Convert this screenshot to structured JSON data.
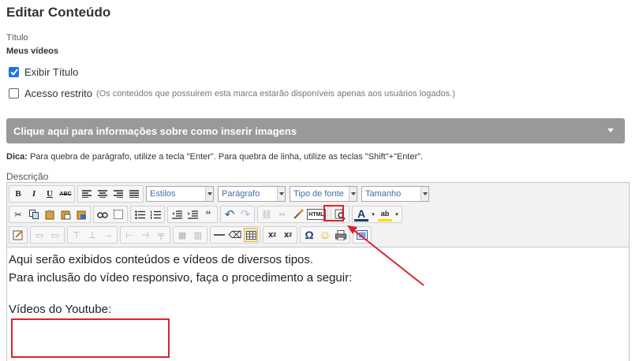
{
  "page": {
    "title": "Editar Conteúdo"
  },
  "title_field": {
    "label": "Título",
    "value": "Meus vídeos"
  },
  "show_title": {
    "label": "Exibir Título",
    "checked": true
  },
  "restricted": {
    "label": "Acesso restrito",
    "hint": "(Os conteúdos que possuirem esta marca estarão disponíveis apenas aos usuários logados.)",
    "checked": false
  },
  "images_accordion": {
    "label": "Clique aqui para informações sobre como inserir imagens"
  },
  "tip": {
    "prefix": "Dica:",
    "text": "Para quebra de parágrafo, utilize a tecla \"Enter\". Para quebra de linha, utilize as teclas \"Shift\"+\"Enter\"."
  },
  "description": {
    "label": "Descrição"
  },
  "toolbar": {
    "styles": "Estilos",
    "paragraph": "Parágrafo",
    "font": "Tipo de fonte",
    "size": "Tamanho",
    "html_button": "HTML"
  },
  "editor": {
    "line1": "Aqui serão exibidos conteúdos e vídeos de diversos tipos.",
    "line2": "Para inclusão do vídeo responsivo, faça o procedimento a seguir:",
    "line3": "Vídeos do Youtube:"
  },
  "colors": {
    "accent": "#1a73e8",
    "highlight": "#d9232f",
    "accordion": "#999999"
  }
}
